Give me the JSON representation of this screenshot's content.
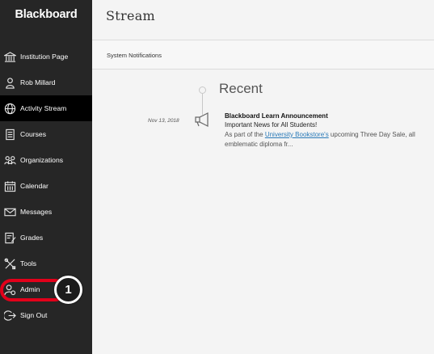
{
  "sidebar": {
    "brand": "Blackboard",
    "items": [
      {
        "label": "Institution Page",
        "icon": "institution-icon"
      },
      {
        "label": "Rob Millard",
        "icon": "user-icon"
      },
      {
        "label": "Activity Stream",
        "icon": "globe-icon",
        "active": true
      },
      {
        "label": "Courses",
        "icon": "courses-icon"
      },
      {
        "label": "Organizations",
        "icon": "organizations-icon"
      },
      {
        "label": "Calendar",
        "icon": "calendar-icon"
      },
      {
        "label": "Messages",
        "icon": "envelope-icon"
      },
      {
        "label": "Grades",
        "icon": "grades-icon"
      },
      {
        "label": "Tools",
        "icon": "tools-icon"
      },
      {
        "label": "Admin",
        "icon": "admin-icon"
      },
      {
        "label": "Sign Out",
        "icon": "sign-out-icon"
      }
    ]
  },
  "callout": {
    "step": "1",
    "color": "#e2001a"
  },
  "main": {
    "title": "Stream",
    "notifications_link": "System Notifications",
    "section": "Recent",
    "entry": {
      "date": "Nov 13, 2018",
      "title": "Blackboard Learn Announcement",
      "subtitle": "Important News for All Students!",
      "body_prefix": "As part of the ",
      "body_link": "University Bookstore's",
      "body_suffix": " upcoming Three Day Sale, all emblematic diploma fr...",
      "icon": "megaphone-icon"
    }
  },
  "colors": {
    "sidebar": "#262626",
    "active": "#000000",
    "link": "#2a7ab8"
  }
}
